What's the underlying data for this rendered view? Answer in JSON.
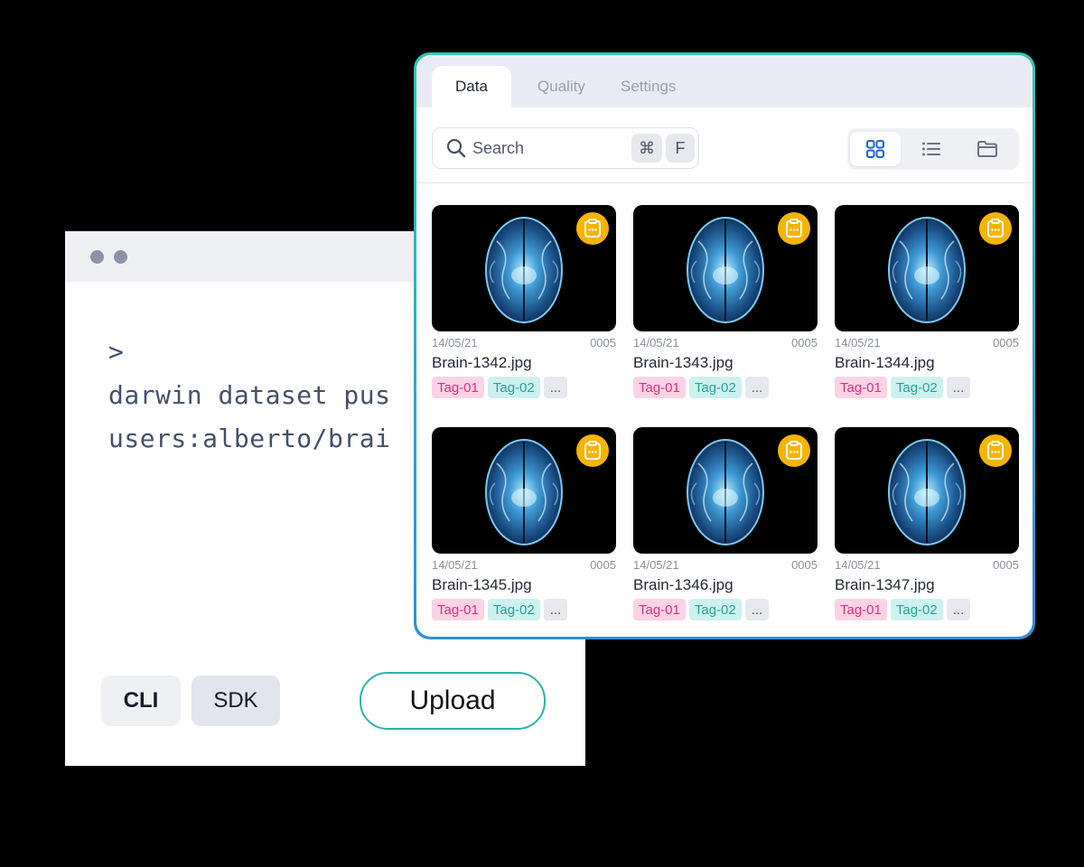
{
  "terminal": {
    "prompt": ">",
    "command_line1": "darwin dataset pus",
    "command_line2": "users:alberto/brai",
    "cli_label": "CLI",
    "sdk_label": "SDK",
    "upload_label": "Upload"
  },
  "panel": {
    "tabs": [
      "Data",
      "Quality",
      "Settings"
    ],
    "search": {
      "placeholder": "Search",
      "shortcut_key1": "⌘",
      "shortcut_key2": "F"
    },
    "view_modes": [
      "grid-icon",
      "list-icon",
      "folder-icon"
    ],
    "status_color": "#f5b400",
    "items": [
      {
        "date": "14/05/21",
        "count": "0005",
        "filename": "Brain-1342.jpg",
        "tags": [
          "Tag-01",
          "Tag-02",
          "..."
        ]
      },
      {
        "date": "14/05/21",
        "count": "0005",
        "filename": "Brain-1343.jpg",
        "tags": [
          "Tag-01",
          "Tag-02",
          "..."
        ]
      },
      {
        "date": "14/05/21",
        "count": "0005",
        "filename": "Brain-1344.jpg",
        "tags": [
          "Tag-01",
          "Tag-02",
          "..."
        ]
      },
      {
        "date": "14/05/21",
        "count": "0005",
        "filename": "Brain-1345.jpg",
        "tags": [
          "Tag-01",
          "Tag-02",
          "..."
        ]
      },
      {
        "date": "14/05/21",
        "count": "0005",
        "filename": "Brain-1346.jpg",
        "tags": [
          "Tag-01",
          "Tag-02",
          "..."
        ]
      },
      {
        "date": "14/05/21",
        "count": "0005",
        "filename": "Brain-1347.jpg",
        "tags": [
          "Tag-01",
          "Tag-02",
          "..."
        ]
      }
    ]
  }
}
